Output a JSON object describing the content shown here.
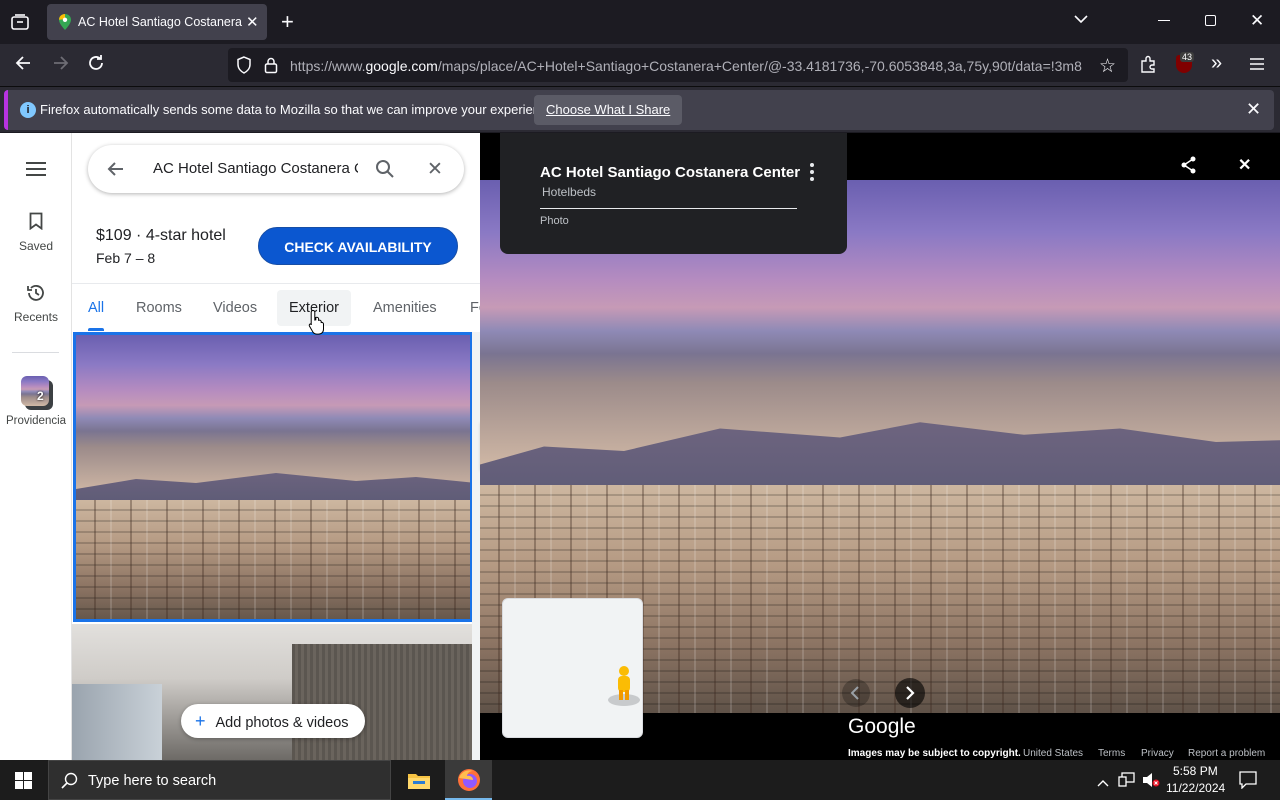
{
  "browser": {
    "tab_title": "AC Hotel Santiago Costanera C",
    "url_prefix": "https://www.",
    "url_domain": "google.com",
    "url_rest": "/maps/place/AC+Hotel+Santiago+Costanera+Center/@-33.4181736,-70.6053848,3a,75y,90t/data=!3m8",
    "extensions_badge": "43",
    "notice_text": "Firefox automatically sends some data to Mozilla so that we can improve your experience.",
    "notice_button": "Choose What I Share"
  },
  "rail": {
    "saved": "Saved",
    "recents": "Recents",
    "recent_place_count": "2",
    "recent_place_label": "Providencia"
  },
  "panel": {
    "search_value": "AC Hotel Santiago Costanera C",
    "price_line": "$109 · 4-star hotel",
    "dates": "Feb 7 – 8",
    "check_button": "CHECK AVAILABILITY",
    "tabs": [
      "All",
      "Rooms",
      "Videos",
      "Exterior",
      "Amenities",
      "Fo"
    ],
    "add_photos": "Add photos & videos"
  },
  "viewer": {
    "title": "AC Hotel Santiago Costanera Center",
    "source": "Hotelbeds",
    "type": "Photo",
    "google_logo": "Google",
    "copyright": "Images may be subject to copyright.",
    "country": "United States",
    "terms": "Terms",
    "privacy": "Privacy",
    "report": "Report a problem"
  },
  "taskbar": {
    "search_placeholder": "Type here to search",
    "time": "5:58 PM",
    "date": "11/22/2024"
  },
  "colors": {
    "accent_blue": "#0b57d0",
    "tab_active": "#1a73e8",
    "firefox_notice_bar": "#b833e1"
  }
}
